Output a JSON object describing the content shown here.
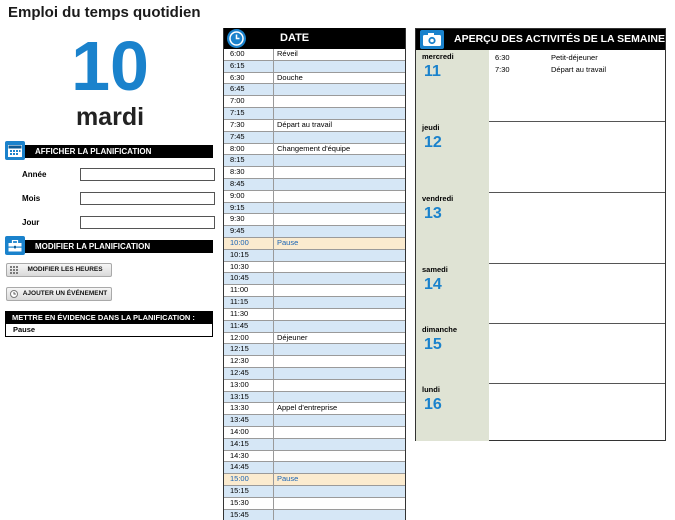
{
  "app": {
    "title": "Emploi du temps quotidien"
  },
  "day": {
    "number": "10",
    "name": "mardi"
  },
  "show_schedule": {
    "label": "AFFICHER LA PLANIFICATION",
    "fields": [
      {
        "label": "Année",
        "value": ""
      },
      {
        "label": "Mois",
        "value": ""
      },
      {
        "label": "Jour",
        "value": ""
      }
    ]
  },
  "modify_schedule": {
    "label": "MODIFIER LA PLANIFICATION",
    "buttons": {
      "edit_hours": "MODIFIER LES HEURES",
      "add_event": "AJOUTER UN ÉVÉNEMENT"
    }
  },
  "highlight": {
    "label": "METTRE EN ÉVIDENCE DANS LA PLANIFICATION :",
    "value": "Pause"
  },
  "schedule": {
    "header": "DATE",
    "rows": [
      {
        "time": "6:00",
        "activity": "Réveil"
      },
      {
        "time": "6:15",
        "activity": ""
      },
      {
        "time": "6:30",
        "activity": "Douche"
      },
      {
        "time": "6:45",
        "activity": ""
      },
      {
        "time": "7:00",
        "activity": ""
      },
      {
        "time": "7:15",
        "activity": ""
      },
      {
        "time": "7:30",
        "activity": "Départ au travail"
      },
      {
        "time": "7:45",
        "activity": ""
      },
      {
        "time": "8:00",
        "activity": "Changement d'équipe"
      },
      {
        "time": "8:15",
        "activity": ""
      },
      {
        "time": "8:30",
        "activity": ""
      },
      {
        "time": "8:45",
        "activity": ""
      },
      {
        "time": "9:00",
        "activity": ""
      },
      {
        "time": "9:15",
        "activity": ""
      },
      {
        "time": "9:30",
        "activity": ""
      },
      {
        "time": "9:45",
        "activity": ""
      },
      {
        "time": "10:00",
        "activity": "Pause",
        "highlight": true
      },
      {
        "time": "10:15",
        "activity": ""
      },
      {
        "time": "10:30",
        "activity": ""
      },
      {
        "time": "10:45",
        "activity": ""
      },
      {
        "time": "11:00",
        "activity": ""
      },
      {
        "time": "11:15",
        "activity": ""
      },
      {
        "time": "11:30",
        "activity": ""
      },
      {
        "time": "11:45",
        "activity": ""
      },
      {
        "time": "12:00",
        "activity": "Déjeuner"
      },
      {
        "time": "12:15",
        "activity": ""
      },
      {
        "time": "12:30",
        "activity": ""
      },
      {
        "time": "12:45",
        "activity": ""
      },
      {
        "time": "13:00",
        "activity": ""
      },
      {
        "time": "13:15",
        "activity": ""
      },
      {
        "time": "13:30",
        "activity": "Appel d'entreprise"
      },
      {
        "time": "13:45",
        "activity": ""
      },
      {
        "time": "14:00",
        "activity": ""
      },
      {
        "time": "14:15",
        "activity": ""
      },
      {
        "time": "14:30",
        "activity": ""
      },
      {
        "time": "14:45",
        "activity": ""
      },
      {
        "time": "15:00",
        "activity": "Pause",
        "highlight": true
      },
      {
        "time": "15:15",
        "activity": ""
      },
      {
        "time": "15:30",
        "activity": ""
      },
      {
        "time": "15:45",
        "activity": ""
      }
    ]
  },
  "week": {
    "header": "APERÇU DES ACTIVITÉS DE LA SEMAINE",
    "days": [
      {
        "name": "mercredi",
        "date": "11",
        "events": [
          {
            "time": "6:30",
            "label": "Petit-déjeuner"
          },
          {
            "time": "7:30",
            "label": "Départ au travail"
          }
        ]
      },
      {
        "name": "jeudi",
        "date": "12",
        "events": []
      },
      {
        "name": "vendredi",
        "date": "13",
        "events": []
      },
      {
        "name": "samedi",
        "date": "14",
        "events": []
      },
      {
        "name": "dimanche",
        "date": "15",
        "events": []
      },
      {
        "name": "lundi",
        "date": "16",
        "events": []
      }
    ]
  },
  "colors": {
    "accent": "#1a82cc",
    "alt_row": "#d6e7f6",
    "break_row": "#fbebcf",
    "day_panel": "#dfe3d4"
  }
}
